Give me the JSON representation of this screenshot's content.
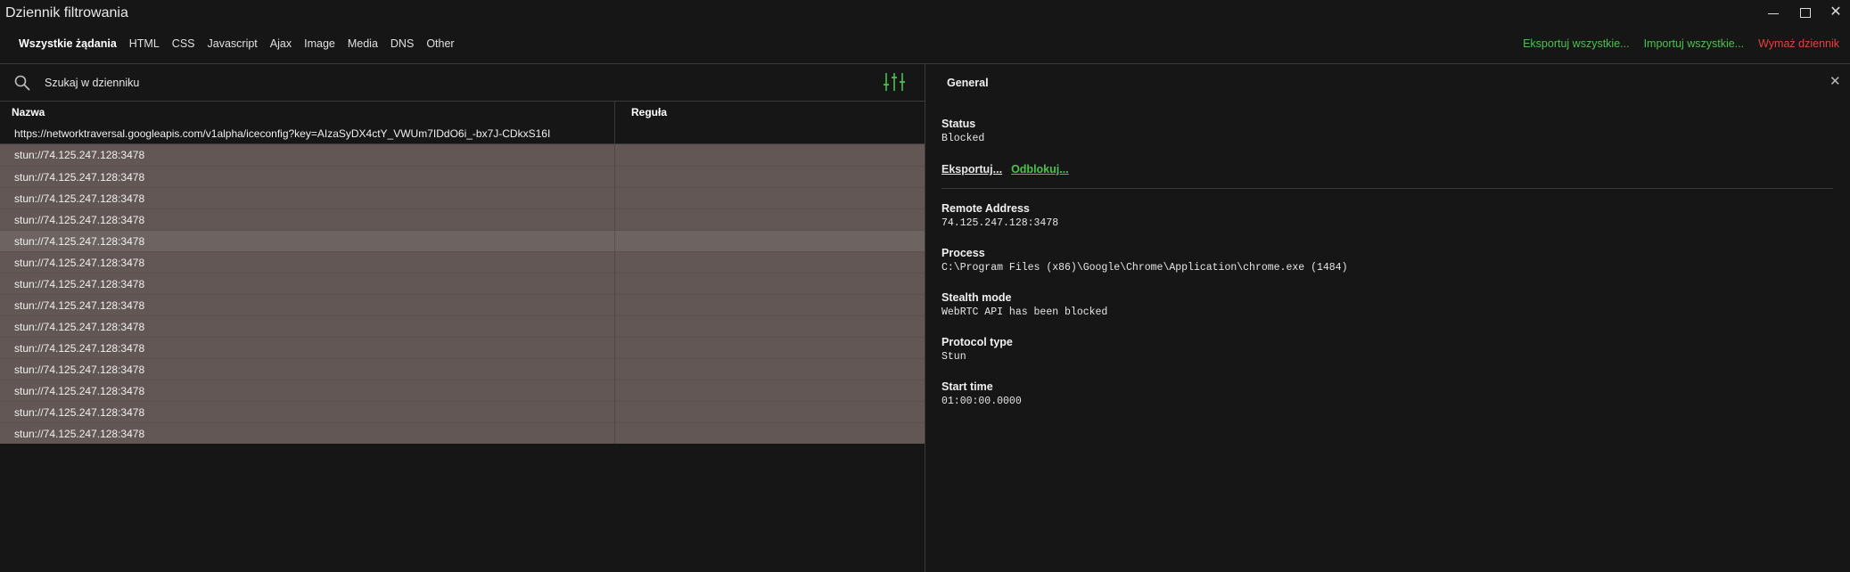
{
  "window": {
    "title": "Dziennik filtrowania"
  },
  "tabs": [
    {
      "label": "Wszystkie żądania",
      "active": true
    },
    {
      "label": "HTML"
    },
    {
      "label": "CSS"
    },
    {
      "label": "Javascript"
    },
    {
      "label": "Ajax"
    },
    {
      "label": "Image"
    },
    {
      "label": "Media"
    },
    {
      "label": "DNS"
    },
    {
      "label": "Other"
    }
  ],
  "actions": {
    "export_all": "Eksportuj wszystkie...",
    "import_all": "Importuj wszystkie...",
    "clear_log": "Wymaż dziennik"
  },
  "search": {
    "placeholder": "Szukaj w dzienniku"
  },
  "table": {
    "columns": [
      "Nazwa",
      "Reguła"
    ],
    "rows": [
      {
        "name": "https://networktraversal.googleapis.com/v1alpha/iceconfig?key=AIzaSyDX4ctY_VWUm7IDdO6i_-bx7J-CDkxS16I",
        "rule": "",
        "blocked": false
      },
      {
        "name": "stun://74.125.247.128:3478",
        "rule": "",
        "blocked": true
      },
      {
        "name": "stun://74.125.247.128:3478",
        "rule": "",
        "blocked": true
      },
      {
        "name": "stun://74.125.247.128:3478",
        "rule": "",
        "blocked": true
      },
      {
        "name": "stun://74.125.247.128:3478",
        "rule": "",
        "blocked": true
      },
      {
        "name": "stun://74.125.247.128:3478",
        "rule": "",
        "blocked": true,
        "selected": true
      },
      {
        "name": "stun://74.125.247.128:3478",
        "rule": "",
        "blocked": true
      },
      {
        "name": "stun://74.125.247.128:3478",
        "rule": "",
        "blocked": true
      },
      {
        "name": "stun://74.125.247.128:3478",
        "rule": "",
        "blocked": true
      },
      {
        "name": "stun://74.125.247.128:3478",
        "rule": "",
        "blocked": true
      },
      {
        "name": "stun://74.125.247.128:3478",
        "rule": "",
        "blocked": true
      },
      {
        "name": "stun://74.125.247.128:3478",
        "rule": "",
        "blocked": true
      },
      {
        "name": "stun://74.125.247.128:3478",
        "rule": "",
        "blocked": true
      },
      {
        "name": "stun://74.125.247.128:3478",
        "rule": "",
        "blocked": true
      },
      {
        "name": "stun://74.125.247.128:3478",
        "rule": "",
        "blocked": true
      }
    ]
  },
  "details": {
    "title": "General",
    "status_label": "Status",
    "status_value": "Blocked",
    "export_link": "Eksportuj...",
    "unblock_link": "Odblokuj...",
    "remote_address_label": "Remote Address",
    "remote_address_value": "74.125.247.128:3478",
    "process_label": "Process",
    "process_value": "C:\\Program Files (x86)\\Google\\Chrome\\Application\\chrome.exe (1484)",
    "stealth_label": "Stealth mode",
    "stealth_value": "WebRTC API has been blocked",
    "protocol_label": "Protocol type",
    "protocol_value": "Stun",
    "start_time_label": "Start time",
    "start_time_value": "01:00:00.0000"
  },
  "colors": {
    "background": "#161616",
    "blocked_row": "#635755",
    "selected_row": "#6d6361",
    "accent_green": "#4cc24c",
    "accent_red": "#e8403c"
  }
}
